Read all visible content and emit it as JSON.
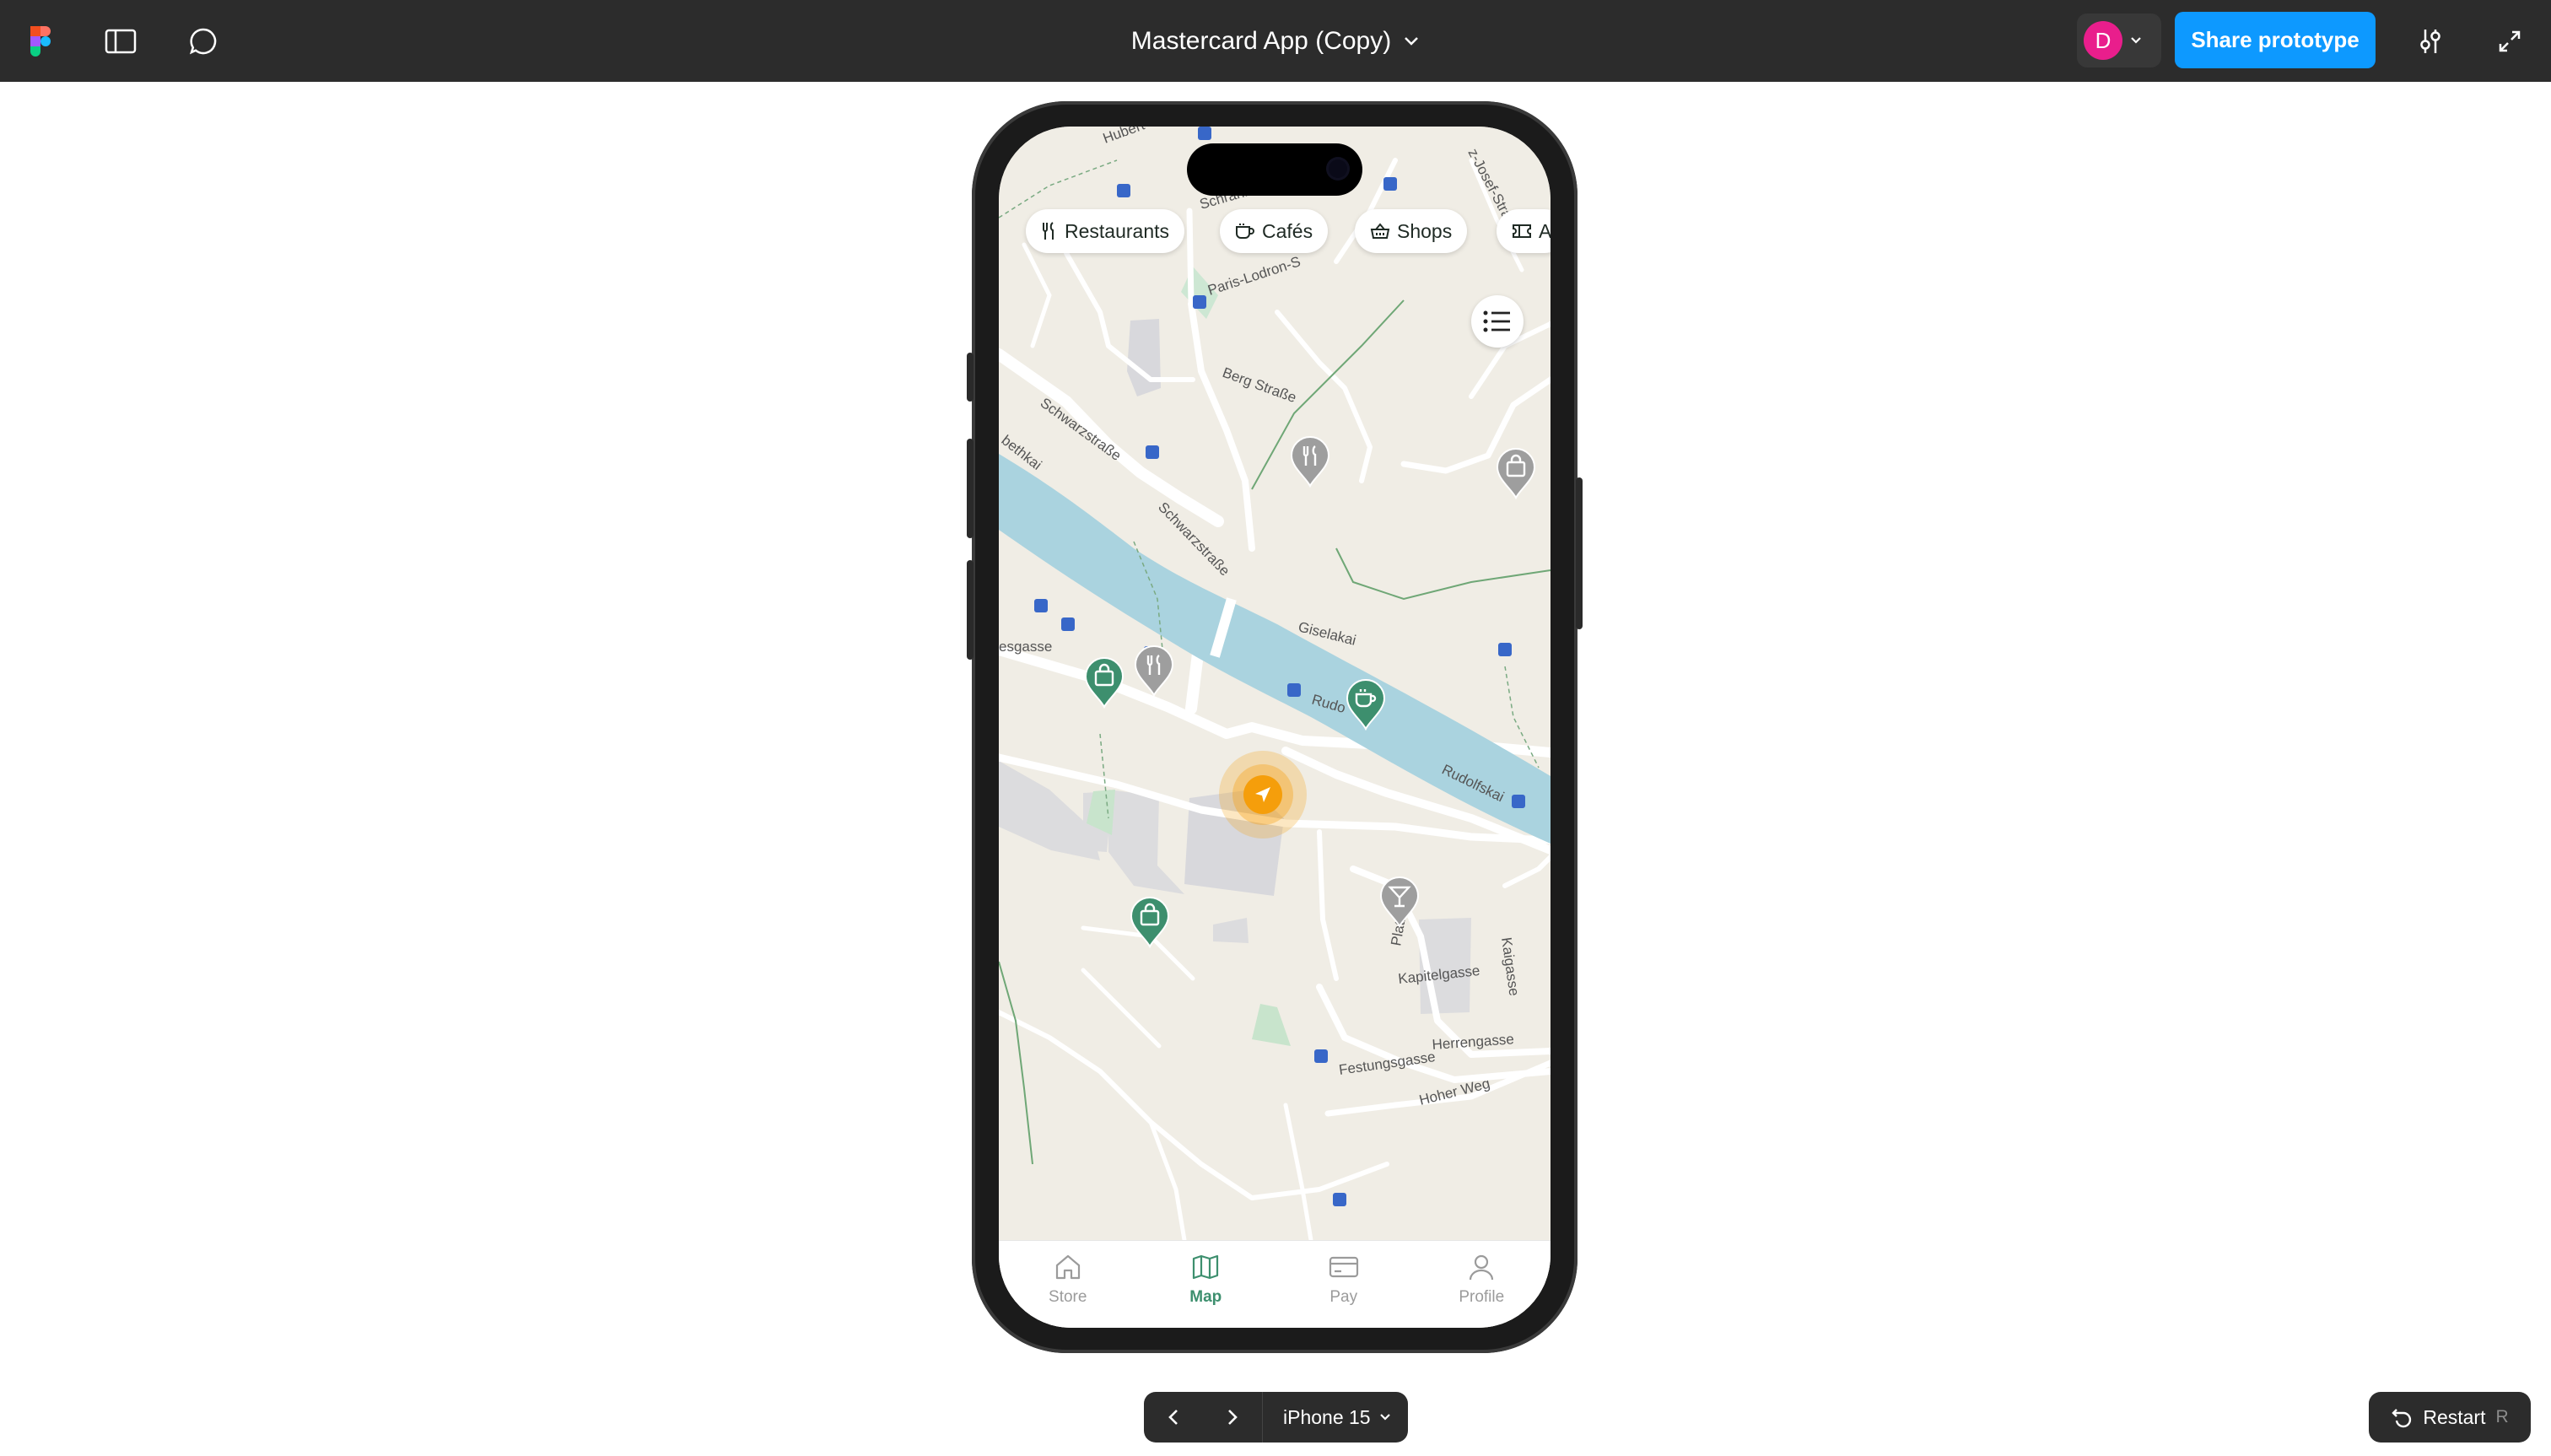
{
  "figma": {
    "file_title": "Mastercard App (Copy)",
    "avatar_initial": "D",
    "share_label": "Share prototype",
    "device_label": "iPhone 15",
    "restart_label": "Restart",
    "restart_shortcut": "R"
  },
  "app": {
    "filters": [
      {
        "label": "Restaurants",
        "icon": "fork-knife-icon"
      },
      {
        "label": "Cafés",
        "icon": "coffee-cup-icon"
      },
      {
        "label": "Shops",
        "icon": "shopping-basket-icon"
      },
      {
        "label": "A",
        "icon": "ticket-icon"
      }
    ],
    "map_labels": {
      "hubert": "Hubert",
      "franz_josef": "z-Josef-Stra",
      "paris_lodron": "Paris-Lodron-S",
      "berg": "Berg Straße",
      "schwarz1": "Schwarzstraße",
      "schwarz2": "Schwarzstraße",
      "elisabethkai": "bethkai",
      "giselakai": "Giselakai",
      "gasse": "esgasse",
      "rudo": "Rudo",
      "rudolfskai": "Rudolfskai",
      "kapitel": "Kapitelgasse",
      "kaigasse": "Kaigasse",
      "herren": "Herrengasse",
      "festung": "Festungsgasse",
      "hoher": "Hoher Weg",
      "platz": "Platz",
      "schrann": "Schrann"
    },
    "tabs": [
      {
        "label": "Store",
        "icon": "home-icon",
        "active": false
      },
      {
        "label": "Map",
        "icon": "map-icon",
        "active": true
      },
      {
        "label": "Pay",
        "icon": "card-icon",
        "active": false
      },
      {
        "label": "Profile",
        "icon": "person-icon",
        "active": false
      }
    ],
    "colors": {
      "accent": "#3d8f6e",
      "location": "#f59e0b",
      "river": "#aad3df",
      "land": "#f0ede5",
      "pin_grey": "#9e9e9e",
      "pin_green": "#3d8f6e"
    }
  }
}
